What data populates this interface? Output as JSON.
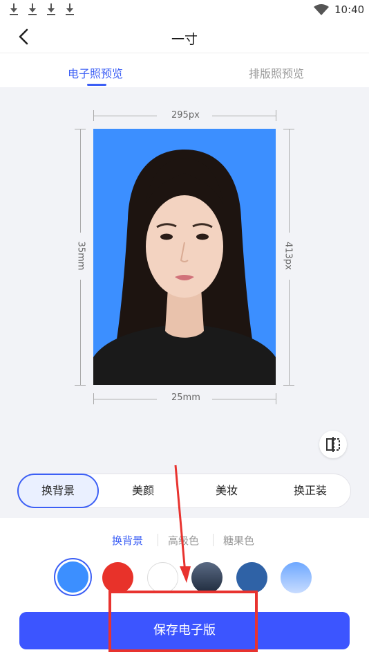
{
  "status_bar": {
    "time": "10:40"
  },
  "header": {
    "title": "一寸",
    "back_icon": "chevron-left-icon"
  },
  "tabs": [
    {
      "label": "电子照预览",
      "active": true
    },
    {
      "label": "排版照预览",
      "active": false
    }
  ],
  "photo": {
    "width_px_label": "295px",
    "height_px_label": "413px",
    "width_mm_label": "25mm",
    "height_mm_label": "35mm",
    "background_color": "#3c8fff"
  },
  "function_tabs": [
    {
      "label": "换背景",
      "selected": true
    },
    {
      "label": "美颜",
      "selected": false
    },
    {
      "label": "美妆",
      "selected": false
    },
    {
      "label": "换正装",
      "selected": false
    }
  ],
  "sub_tabs": [
    {
      "label": "换背景",
      "active": true
    },
    {
      "label": "高级色",
      "active": false
    },
    {
      "label": "糖果色",
      "active": false
    }
  ],
  "colors": [
    "#3c8fff",
    "#e8322a",
    "#ffffff",
    "#2b3a52",
    "#2f62a6",
    "#8fbaff"
  ],
  "save_button": {
    "label": "保存电子版"
  },
  "accent_color": "#3c5ff5",
  "annotation_color": "#e8332f"
}
